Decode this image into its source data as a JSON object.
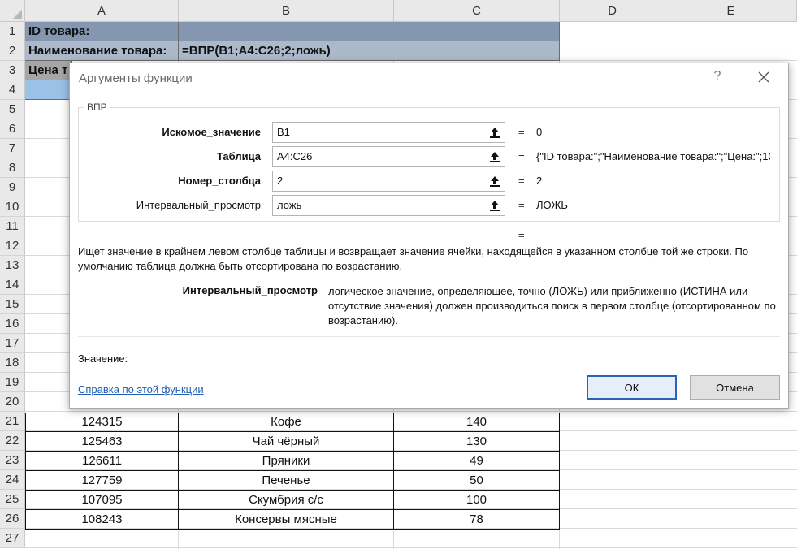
{
  "sheet": {
    "columns": [
      "A",
      "B",
      "C",
      "D",
      "E"
    ],
    "rows": [
      "1",
      "2",
      "3",
      "4",
      "5",
      "6",
      "7",
      "8",
      "9",
      "10",
      "11",
      "12",
      "13",
      "14",
      "15",
      "16",
      "17",
      "18",
      "19",
      "20",
      "21",
      "22",
      "23",
      "24",
      "25",
      "26",
      "27"
    ],
    "cell_A1": "ID товара:",
    "cell_A2": "Наименование товара:",
    "cell_B2": "=ВПР(B1;A4:C26;2;ложь)",
    "cell_A3": "Цена т",
    "table_rows": [
      {
        "id": "124315",
        "name": "Кофе",
        "price": "140"
      },
      {
        "id": "125463",
        "name": "Чай чёрный",
        "price": "130"
      },
      {
        "id": "126611",
        "name": "Пряники",
        "price": "49"
      },
      {
        "id": "127759",
        "name": "Печенье",
        "price": "50"
      },
      {
        "id": "107095",
        "name": "Скумбрия с/с",
        "price": "100"
      },
      {
        "id": "108243",
        "name": "Консервы мясные",
        "price": "78"
      }
    ],
    "header_fill": "#8496b0",
    "header_fill_light": "#acb9ca",
    "header_fill_gray": "#a6a6a6",
    "row4_fill": "#9bc2e6"
  },
  "dialog": {
    "title": "Аргументы функции",
    "help_glyph": "?",
    "function_name": "ВПР",
    "args": [
      {
        "label": "Искомое_значение",
        "value": "B1",
        "result": "0"
      },
      {
        "label": "Таблица",
        "value": "A4:C26",
        "result": "{\"ID товара:\";\"Наименование товара:\";\"Цена:\";10"
      },
      {
        "label": "Номер_столбца",
        "value": "2",
        "result": "2"
      },
      {
        "label": "Интервальный_просмотр",
        "value": "ложь",
        "result": "ЛОЖЬ"
      }
    ],
    "eq": "=",
    "description": "Ищет значение в крайнем левом столбце таблицы и возвращает значение ячейки, находящейся в указанном столбце той же строки. По умолчанию таблица должна быть отсортирована по возрастанию.",
    "arg_desc_name": "Интервальный_просмотр",
    "arg_desc_text": "логическое значение, определяющее, точно (ЛОЖЬ) или приближенно (ИСТИНА или отсутствие значения) должен производиться поиск в первом столбце (отсортированном по возрастанию).",
    "value_label": "Значение:",
    "help_link": "Справка по этой функции",
    "ok_label": "ОК",
    "cancel_label": "Отмена",
    "icons": [
      "close-icon",
      "collapse-dialog-icon"
    ],
    "accent": "#2a64b8"
  }
}
